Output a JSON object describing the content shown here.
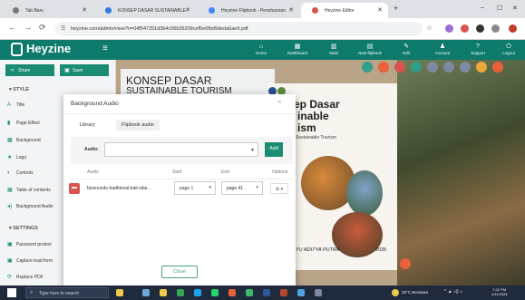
{
  "browser": {
    "tabs": [
      {
        "label": "Tab Baru"
      },
      {
        "label": "KONSEP DASAR SUSTAINABLE"
      },
      {
        "label": "Heyzine Flipbook - Penelusuran"
      },
      {
        "label": "Heyzine Editor"
      }
    ],
    "new_tab": "+",
    "url": "heyzine.com/admin/view?n=04f547251d3b4c56b36209cef5e0fbd9deda6ae9.pdf",
    "window_controls": [
      "–",
      "☐",
      "✕"
    ]
  },
  "app": {
    "logo": "Heyzine",
    "menu_glyph": "≡",
    "nav": [
      {
        "label": "Home",
        "glyph": "⌂"
      },
      {
        "label": "Dashboard",
        "glyph": "▦"
      },
      {
        "label": "Stats",
        "glyph": "▥"
      },
      {
        "label": "New flipbook",
        "glyph": "▤"
      },
      {
        "label": "Edit",
        "glyph": "✎"
      },
      {
        "label": "Account",
        "glyph": "♟"
      },
      {
        "label": "Support",
        "glyph": "?"
      },
      {
        "label": "Logout",
        "glyph": "⏻"
      }
    ]
  },
  "sidebar": {
    "share_label": "Share",
    "save_label": "Save",
    "style_heading": "▾ STYLE",
    "style_items": [
      {
        "label": "Title",
        "glyph": "A"
      },
      {
        "label": "Page Effect",
        "glyph": "▮"
      },
      {
        "label": "Background",
        "glyph": "▩"
      },
      {
        "label": "Logo",
        "glyph": "★"
      },
      {
        "label": "Controls",
        "glyph": "◐"
      },
      {
        "label": "Table of contents",
        "glyph": "▦"
      },
      {
        "label": "Background Audio",
        "glyph": "◂)"
      }
    ],
    "settings_heading": "▾ SETTINGS",
    "settings_items": [
      {
        "label": "Password protect",
        "glyph": "▣"
      },
      {
        "label": "Capture lead form",
        "glyph": "▣"
      },
      {
        "label": "Replace PDF",
        "glyph": "⟳"
      }
    ]
  },
  "book": {
    "left_title": "KONSEP DASAR",
    "left_title2": "SUSTAINABLE TOURISM",
    "right_title": "ep Dasar",
    "right_title2": "inable",
    "right_title3": "ism",
    "right_subtitle": "Sustainable Tourism",
    "author": "YU ADITYA PUTRA",
    "year": "2025"
  },
  "modal": {
    "title": "Background Audio",
    "close_glyph": "×",
    "tabs": [
      {
        "label": "Library"
      },
      {
        "label": "Flipbook audio"
      }
    ],
    "audio_label": "Audio:",
    "audio_value": "",
    "add_label": "Add",
    "columns": {
      "audio": "Audio",
      "start": "Start",
      "end": "End",
      "options": "Options"
    },
    "rows": [
      {
        "track": "fassounds-traditional-bali-vibe...",
        "start": "page 1",
        "end": "page 41",
        "options": "⚙ ▾"
      }
    ],
    "close_label": "Close"
  },
  "taskbar": {
    "search_placeholder": "Type here to search",
    "weather": "29°C  Berawan",
    "time": "7:02 PM",
    "date": "4/11/2025"
  },
  "colors": {
    "brand": "#0d7a6b",
    "accent": "#1a8c73",
    "danger": "#d9534f"
  }
}
